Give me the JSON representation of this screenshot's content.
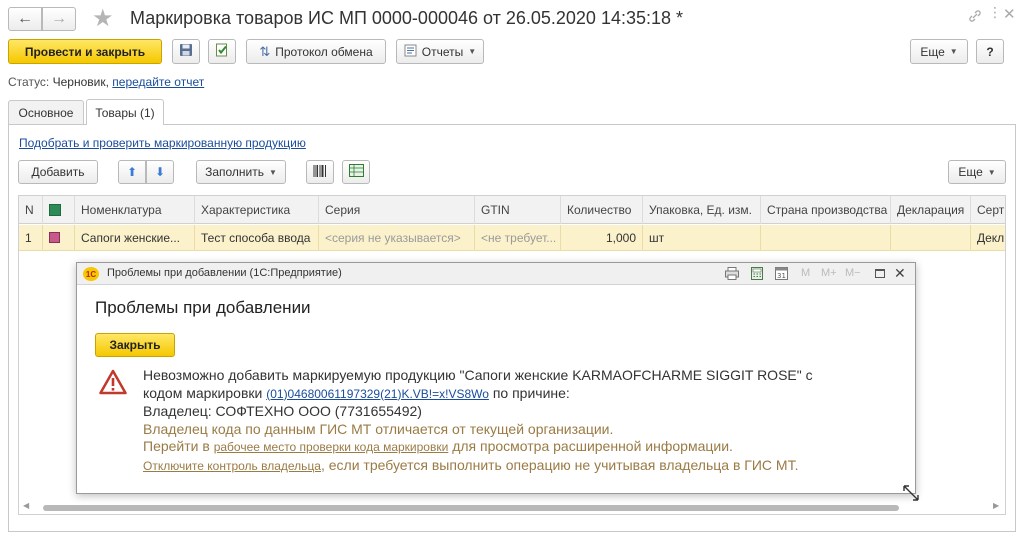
{
  "window": {
    "title": "Маркировка товаров ИС МП 0000-000046 от 26.05.2020 14:35:18 *"
  },
  "toolbar": {
    "post_close_label": "Провести и закрыть",
    "protocol_label": "Протокол обмена",
    "reports_label": "Отчеты",
    "more_label": "Еще",
    "help_label": "?"
  },
  "status": {
    "label": "Статус:",
    "value": "Черновик,",
    "link": "передайте отчет"
  },
  "tabs": [
    {
      "label": "Основное"
    },
    {
      "label": "Товары (1)"
    }
  ],
  "goods": {
    "pick_link": "Подобрать и проверить маркированную продукцию",
    "add_label": "Добавить",
    "fill_label": "Заполнить",
    "more_label": "Еще",
    "columns": {
      "n": "N",
      "nomenclature": "Номенклатура",
      "characteristic": "Характеристика",
      "series": "Серия",
      "gtin": "GTIN",
      "quantity": "Количество",
      "package": "Упаковка, Ед. изм.",
      "country": "Страна производства",
      "declaration": "Декларация",
      "cert": "Серт"
    },
    "rows": [
      {
        "n": "1",
        "nomenclature": "Сапоги женские...",
        "characteristic": "Тест способа ввода",
        "series": "<серия не указывается>",
        "gtin": "<не требует...",
        "quantity": "1,000",
        "package": "шт",
        "country": "",
        "declaration": "",
        "cert": "Декл"
      }
    ]
  },
  "dialog": {
    "window_title": "Проблемы при добавлении (1С:Предприятие)",
    "heading": "Проблемы при добавлении",
    "close_label": "Закрыть",
    "msg_line1": "Невозможно добавить маркируемую продукцию \"Сапоги женские KARMAOFCHARME SIGGIT ROSE\" с",
    "msg_line2_prefix": "кодом маркировки",
    "msg_code_link": "(01)04680061197329(21)K.VB!=x!VS8Wo",
    "msg_line2_suffix": "по причине:",
    "owner_line": "Владелец: СОФТЕХНО ООО (7731655492)",
    "differs_line": "Владелец кода по данным ГИС МТ отличается от текущей организации.",
    "goto_prefix": "Перейти в",
    "goto_link": "рабочее место проверки кода маркировки",
    "goto_suffix": "для просмотра расширенной информации.",
    "disable_link": "Отключите контроль владельца",
    "disable_suffix": ", если требуется выполнить операцию не учитывая владельца в ГИС МТ.",
    "tb_m": "M",
    "tb_mplus": "M+",
    "tb_mminus": "M−"
  },
  "colors": {
    "accent_yellow": "#f5c800",
    "link_blue": "#1a4c9b",
    "row_highlight": "#fbf2cc",
    "warning_red": "#c0392b",
    "brown_text": "#9a7b45"
  },
  "icons": [
    "back-icon",
    "forward-icon",
    "star-icon",
    "link-icon",
    "close-icon",
    "save-icon",
    "post-icon",
    "exchange-icon",
    "reports-icon",
    "arrow-up-icon",
    "arrow-down-icon",
    "barcode-icon",
    "excel-icon",
    "warning-icon",
    "print-icon",
    "calculator-icon",
    "calendar-icon",
    "maximize-icon",
    "resize-icon",
    "onec-logo-icon"
  ]
}
